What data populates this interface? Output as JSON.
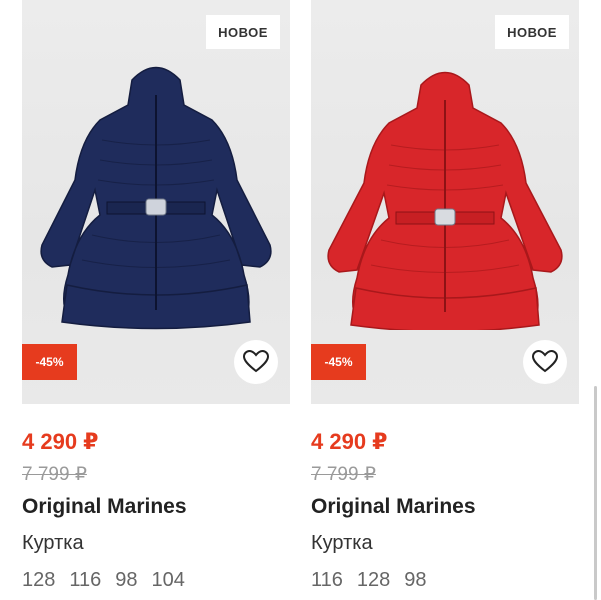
{
  "products": [
    {
      "badge_new": "НОВОЕ",
      "discount": "-45%",
      "price": "4 290 ₽",
      "old_price": "7 799 ₽",
      "brand": "Original Marines",
      "type": "Куртка",
      "sizes": [
        "128",
        "116",
        "98",
        "104"
      ],
      "coat_color": "#1f2c5c"
    },
    {
      "badge_new": "НОВОЕ",
      "discount": "-45%",
      "price": "4 290 ₽",
      "old_price": "7 799 ₽",
      "brand": "Original Marines",
      "type": "Куртка",
      "sizes": [
        "116",
        "128",
        "98"
      ],
      "coat_color": "#d8262a"
    }
  ],
  "colors": {
    "accent": "#e63b1e"
  },
  "icons": [
    "heart-icon"
  ]
}
